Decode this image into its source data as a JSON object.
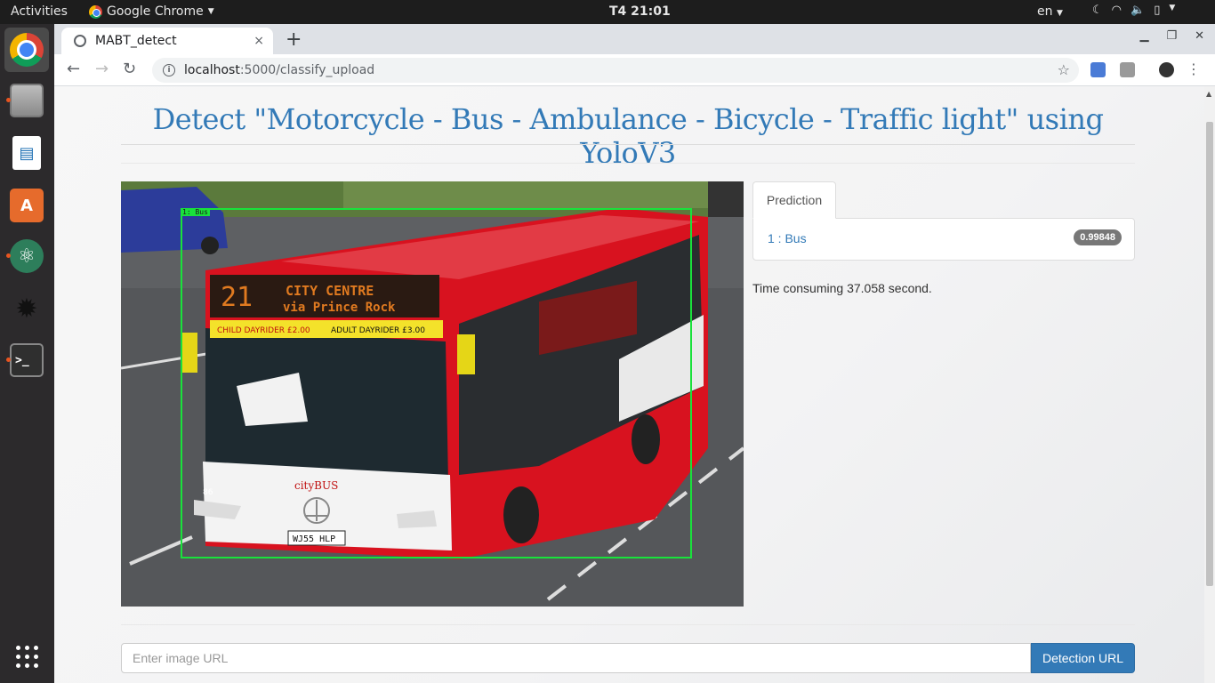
{
  "topbar": {
    "activities": "Activities",
    "app_name": "Google Chrome",
    "clock": "T4 21:01",
    "language": "en"
  },
  "dock": {
    "items": [
      "chrome-icon",
      "files-icon",
      "writer-icon",
      "software-store-icon",
      "atom-icon",
      "settings-icon",
      "terminal-icon",
      "show-apps-icon"
    ],
    "terminal_glyph": ">_"
  },
  "browser": {
    "tab_title": "MABT_detect",
    "tab_close": "×",
    "new_tab": "+",
    "url_host": "localhost",
    "url_rest": ":5000/classify_upload",
    "icons": [
      "back-icon",
      "forward-icon",
      "reload-icon",
      "info-icon",
      "bookmark-star-icon",
      "translate-icon",
      "extension-icon",
      "profile-avatar-icon",
      "menu-icon"
    ]
  },
  "page": {
    "heading": "Detect \"Motorcycle - Bus - Ambulance - Bicycle - Traffic light\" using YoloV3",
    "detection_box_label": "1: Bus",
    "tab_label": "Prediction",
    "prediction": {
      "label": "1 : Bus",
      "score": "0.99848"
    },
    "time_text": "Time consuming 37.058 second.",
    "url_input": {
      "placeholder": "Enter image URL",
      "value": ""
    },
    "detect_button": "Detection URL"
  },
  "photo_text": {
    "route_number": "21",
    "destination_line1": "CITY CENTRE",
    "destination_line2": "via Prince Rock",
    "fare_banner_left": "CHILD DAYRIDER £2.00",
    "fare_banner_right": "ADULT DAYRIDER £3.00",
    "plate": "WJ55 HLP",
    "fleet_number": "86",
    "brand": "cityBUS"
  },
  "colors": {
    "accent": "#337ab7",
    "bbox": "#19e23b",
    "badge": "#777777",
    "bus_red": "#d8121f"
  }
}
